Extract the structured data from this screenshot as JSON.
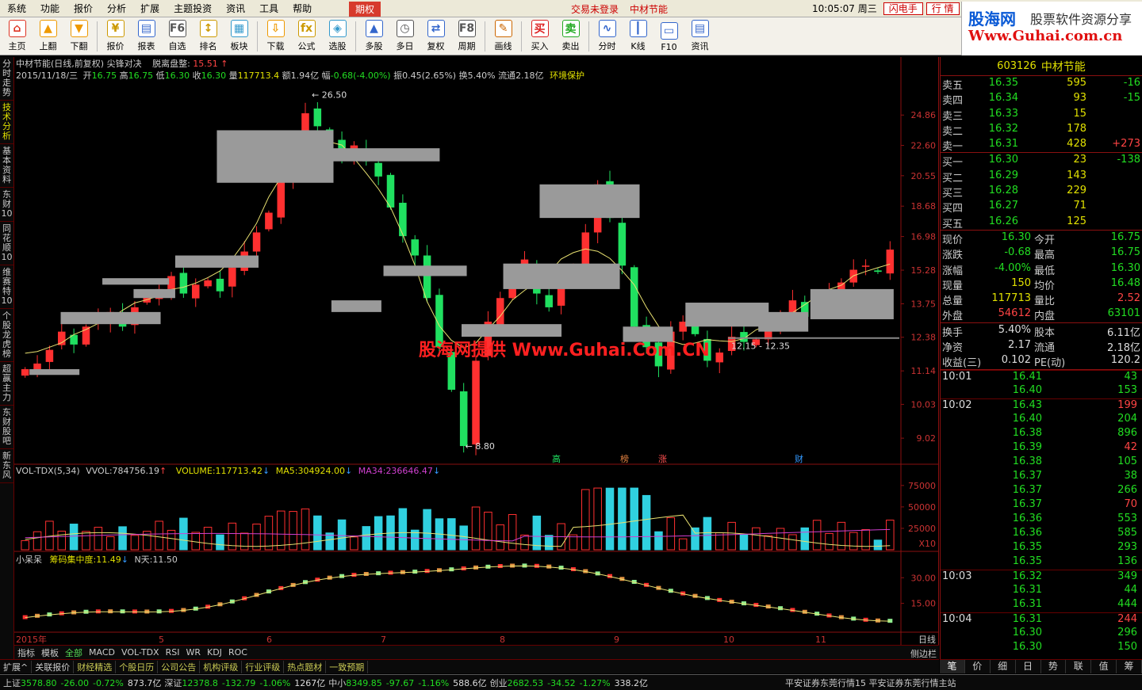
{
  "menu": {
    "items": [
      "系统",
      "功能",
      "报价",
      "分析",
      "扩展",
      "主题投资",
      "资讯",
      "工具",
      "帮助"
    ],
    "period_tab": "期权",
    "trade_status": "交易未登录",
    "stock_title": "中材节能",
    "clock": "10:05:07 周三",
    "flash_btn": "闪电手",
    "quote_btn": "行 情",
    "win_btns": [
      "_",
      "▢",
      "✕"
    ]
  },
  "toolbar": [
    {
      "label": "主页",
      "icon": "home-icon",
      "glyph": "⌂",
      "color": "#d32"
    },
    {
      "label": "上翻",
      "icon": "arrow-up-icon",
      "glyph": "▲",
      "color": "#e90"
    },
    {
      "label": "下翻",
      "icon": "arrow-down-icon",
      "glyph": "▼",
      "color": "#e90"
    },
    {
      "sep": true
    },
    {
      "label": "报价",
      "icon": "quote-icon",
      "glyph": "¥",
      "color": "#c90"
    },
    {
      "label": "报表",
      "icon": "report-icon",
      "glyph": "▤",
      "color": "#36c"
    },
    {
      "label": "自选",
      "icon": "watchlist-icon",
      "glyph": "F6",
      "color": "#555"
    },
    {
      "label": "排名",
      "icon": "ranking-icon",
      "glyph": "↕",
      "color": "#c90"
    },
    {
      "label": "板块",
      "icon": "sector-icon",
      "glyph": "▦",
      "color": "#39c"
    },
    {
      "sep": true
    },
    {
      "label": "下载",
      "icon": "download-icon",
      "glyph": "⇩",
      "color": "#e90"
    },
    {
      "label": "公式",
      "icon": "formula-icon",
      "glyph": "fx",
      "color": "#c90"
    },
    {
      "label": "选股",
      "icon": "stock-pick-icon",
      "glyph": "◈",
      "color": "#39c"
    },
    {
      "sep": true
    },
    {
      "label": "多股",
      "icon": "multi-stock-icon",
      "glyph": "▲",
      "color": "#36c"
    },
    {
      "label": "多日",
      "icon": "multi-day-icon",
      "glyph": "◷",
      "color": "#555"
    },
    {
      "label": "复权",
      "icon": "adjust-icon",
      "glyph": "⇄",
      "color": "#36c"
    },
    {
      "label": "周期",
      "icon": "period-icon",
      "glyph": "F8",
      "color": "#555"
    },
    {
      "sep": true
    },
    {
      "label": "画线",
      "icon": "draw-line-icon",
      "glyph": "✎",
      "color": "#c60"
    },
    {
      "sep": true
    },
    {
      "label": "买入",
      "icon": "buy-icon",
      "glyph": "买",
      "color": "#d22"
    },
    {
      "label": "卖出",
      "icon": "sell-icon",
      "glyph": "卖",
      "color": "#2a2"
    },
    {
      "sep": true
    },
    {
      "label": "分时",
      "icon": "intraday-icon",
      "glyph": "∿",
      "color": "#36c"
    },
    {
      "label": "K线",
      "icon": "kline-icon",
      "glyph": "┃",
      "color": "#36c"
    },
    {
      "label": "F10",
      "icon": "f10-icon",
      "glyph": "▭",
      "color": "#36c"
    },
    {
      "label": "资讯",
      "icon": "news-icon",
      "glyph": "▤",
      "color": "#36c"
    }
  ],
  "logo": {
    "main": "股海网",
    "sub": "股票软件资源分享",
    "url": "Www.Guhai.com.cn"
  },
  "left_tabs": [
    "分时走势",
    "技术分析",
    "基本资料",
    "东财10",
    "同花顺10",
    "维赛特10",
    "个股龙虎榜",
    "超赢主力",
    "东财股吧",
    "新东风"
  ],
  "chart_header": {
    "line1": "中材节能(日线,前复权) 尖锋对决",
    "aux_label": "脱离盘整:",
    "aux_value": "15.51",
    "aux_arrow": "↑",
    "date": "2015/11/18/三",
    "open_label": "开",
    "open": "16.75",
    "high_label": "高",
    "high": "16.75",
    "low_label": "低",
    "low": "16.30",
    "close_label": "收",
    "close": "16.30",
    "vol_label": "量",
    "vol": "117713.4",
    "amt_label": "额",
    "amt": "1.94亿",
    "range_label": "幅",
    "range": "-0.68(-4.00%)",
    "amp_label": "振",
    "amp": "0.45(2.65%)",
    "turn_label": "换",
    "turn": "5.40%",
    "float_label": "流通",
    "float": "2.18亿",
    "sector": "环境保护"
  },
  "watermark": "股海网提供 Www.Guhai.Com.CN",
  "vol_header": {
    "name": "VOL-TDX(5,34)",
    "vvol_label": "VVOL:",
    "vvol": "784756.19",
    "volume_label": "VOLUME:",
    "volume": "117713.42",
    "ma5_label": "MA5:",
    "ma5": "304924.00",
    "ma34_label": "MA34:",
    "ma34": "236646.47"
  },
  "chip_header": {
    "name": "小呆呆",
    "conc_label": "筹码集中度:",
    "conc": "11.49",
    "n_label": "N天:",
    "n": "11.50"
  },
  "chart_data": {
    "type": "candlestick",
    "title": "中材节能(日线,前复权)",
    "price_ticks": [
      "24.86",
      "22.60",
      "20.55",
      "18.68",
      "16.98",
      "15.28",
      "13.75",
      "12.38",
      "11.14",
      "10.03",
      "9.02"
    ],
    "vol_ticks": [
      "75000",
      "50000",
      "25000",
      "X10"
    ],
    "chip_ticks": [
      "30.00",
      "15.00"
    ],
    "x_ticks": [
      "2015年",
      "5",
      "6",
      "7",
      "8",
      "9",
      "10",
      "11"
    ],
    "x_end_label": "日线",
    "annotations": [
      "26.50",
      "8.80",
      "12.15 - 12.35"
    ],
    "markers": [
      "高",
      "榜",
      "涨",
      "财"
    ],
    "series": [
      {
        "name": "Close",
        "values": [
          11.2,
          11.4,
          11.9,
          12.6,
          12.1,
          12.8,
          13.2,
          13.4,
          12.8,
          13.6,
          14.1,
          14.4,
          15.0,
          14.2,
          14.6,
          14.8,
          14.3,
          15.4,
          16.2,
          17.2,
          18.3,
          20.5,
          22.0,
          25.0,
          24.0,
          23.0,
          21.8,
          22.6,
          21.5,
          20.5,
          18.6,
          17.0,
          16.0,
          14.0,
          12.0,
          10.5,
          8.8,
          11.5,
          13.0,
          14.0,
          15.3,
          15.8,
          14.2,
          13.6,
          14.5,
          15.5,
          17.2,
          20.0,
          18.0,
          15.5,
          12.8,
          12.0,
          11.3,
          12.6,
          13.0,
          12.5,
          11.5,
          11.8,
          12.4,
          12.2,
          12.3,
          12.8,
          13.3,
          13.9,
          13.2,
          13.8,
          14.3,
          14.7,
          15.3,
          15.5,
          15.2,
          16.3
        ]
      }
    ]
  },
  "right_panel": {
    "code": "603126",
    "name": "中材节能",
    "asks": [
      {
        "label": "卖五",
        "price": "16.35",
        "vol": "595",
        "chg": "-16",
        "chgc": "grn"
      },
      {
        "label": "卖四",
        "price": "16.34",
        "vol": "93",
        "chg": "-15",
        "chgc": "grn"
      },
      {
        "label": "卖三",
        "price": "16.33",
        "vol": "15",
        "chg": "",
        "chgc": "grn"
      },
      {
        "label": "卖二",
        "price": "16.32",
        "vol": "178",
        "chg": "",
        "chgc": "grn"
      },
      {
        "label": "卖一",
        "price": "16.31",
        "vol": "428",
        "chg": "+273",
        "chgc": "red"
      }
    ],
    "bids": [
      {
        "label": "买一",
        "price": "16.30",
        "vol": "23",
        "chg": "-138",
        "chgc": "grn"
      },
      {
        "label": "买二",
        "price": "16.29",
        "vol": "143",
        "chg": "",
        "chgc": "grn"
      },
      {
        "label": "买三",
        "price": "16.28",
        "vol": "229",
        "chg": "",
        "chgc": "grn"
      },
      {
        "label": "买四",
        "price": "16.27",
        "vol": "71",
        "chg": "",
        "chgc": "grn"
      },
      {
        "label": "买五",
        "price": "16.26",
        "vol": "125",
        "chg": "",
        "chgc": "grn"
      }
    ],
    "quotes": [
      {
        "l1": "现价",
        "v1": "16.30",
        "c1": "grn",
        "l2": "今开",
        "v2": "16.75",
        "c2": "grn"
      },
      {
        "l1": "涨跌",
        "v1": "-0.68",
        "c1": "grn",
        "l2": "最高",
        "v2": "16.75",
        "c2": "grn"
      },
      {
        "l1": "涨幅",
        "v1": "-4.00%",
        "c1": "grn",
        "l2": "最低",
        "v2": "16.30",
        "c2": "grn"
      },
      {
        "l1": "现量",
        "v1": "150",
        "c1": "yel",
        "l2": "均价",
        "v2": "16.48",
        "c2": "grn"
      },
      {
        "l1": "总量",
        "v1": "117713",
        "c1": "yel",
        "l2": "量比",
        "v2": "2.52",
        "c2": "red"
      },
      {
        "l1": "外盘",
        "v1": "54612",
        "c1": "red",
        "l2": "内盘",
        "v2": "63101",
        "c2": "grn"
      }
    ],
    "stats": [
      {
        "l1": "换手",
        "v1": "5.40%",
        "c1": "wht",
        "l2": "股本",
        "v2": "6.11亿",
        "c2": "wht"
      },
      {
        "l1": "净资",
        "v1": "2.17",
        "c1": "wht",
        "l2": "流通",
        "v2": "2.18亿",
        "c2": "wht"
      },
      {
        "l1": "收益(三)",
        "v1": "0.102",
        "c1": "wht",
        "l2": "PE(动)",
        "v2": "120.2",
        "c2": "wht"
      }
    ],
    "ticks": [
      {
        "t": "10:01",
        "p": "16.41",
        "v": "43",
        "vc": "grn"
      },
      {
        "t": "",
        "p": "16.40",
        "v": "153",
        "vc": "grn"
      },
      {
        "t": "10:02",
        "p": "16.43",
        "v": "199",
        "vc": "red"
      },
      {
        "t": "",
        "p": "16.40",
        "v": "204",
        "vc": "grn"
      },
      {
        "t": "",
        "p": "16.38",
        "v": "896",
        "vc": "grn"
      },
      {
        "t": "",
        "p": "16.39",
        "v": "42",
        "vc": "red"
      },
      {
        "t": "",
        "p": "16.38",
        "v": "105",
        "vc": "grn"
      },
      {
        "t": "",
        "p": "16.37",
        "v": "38",
        "vc": "grn"
      },
      {
        "t": "",
        "p": "16.37",
        "v": "266",
        "vc": "grn"
      },
      {
        "t": "",
        "p": "16.37",
        "v": "70",
        "vc": "red"
      },
      {
        "t": "",
        "p": "16.36",
        "v": "553",
        "vc": "grn"
      },
      {
        "t": "",
        "p": "16.36",
        "v": "585",
        "vc": "grn"
      },
      {
        "t": "",
        "p": "16.35",
        "v": "293",
        "vc": "grn"
      },
      {
        "t": "",
        "p": "16.35",
        "v": "136",
        "vc": "grn"
      },
      {
        "t": "10:03",
        "p": "16.32",
        "v": "349",
        "vc": "grn"
      },
      {
        "t": "",
        "p": "16.31",
        "v": "44",
        "vc": "grn"
      },
      {
        "t": "",
        "p": "16.31",
        "v": "444",
        "vc": "grn"
      },
      {
        "t": "10:04",
        "p": "16.31",
        "v": "244",
        "vc": "red"
      },
      {
        "t": "",
        "p": "16.30",
        "v": "296",
        "vc": "grn"
      },
      {
        "t": "",
        "p": "16.30",
        "v": "150",
        "vc": "grn"
      }
    ],
    "tabs": [
      "笔",
      "价",
      "细",
      "日",
      "势",
      "联",
      "值",
      "筹"
    ]
  },
  "chart_tabs": [
    "指标",
    "模板",
    "全部",
    "MACD",
    "VOL-TDX",
    "RSI",
    "WR",
    "KDJ",
    "ROC"
  ],
  "sidebar_toggle": "侧边栏<",
  "info_tabs": [
    "扩展^",
    "关联报价",
    "财经精选",
    "个股日历",
    "公司公告",
    "机构评级",
    "行业评级",
    "热点题材",
    "一致预期"
  ],
  "status": [
    {
      "name": "上证",
      "val": "3578.80",
      "chg": "-26.00",
      "pct": "-0.72%",
      "amt": "873.7亿"
    },
    {
      "name": "深证",
      "val": "12378.8",
      "chg": "-132.79",
      "pct": "-1.06%",
      "amt": "1267亿"
    },
    {
      "name": "中小",
      "val": "8349.85",
      "chg": "-97.67",
      "pct": "-1.16%",
      "amt": "588.6亿"
    },
    {
      "name": "创业",
      "val": "2682.53",
      "chg": "-34.52",
      "pct": "-1.27%",
      "amt": "338.2亿"
    }
  ],
  "broker": "平安证券东莞行情15  平安证券东莞行情主站"
}
